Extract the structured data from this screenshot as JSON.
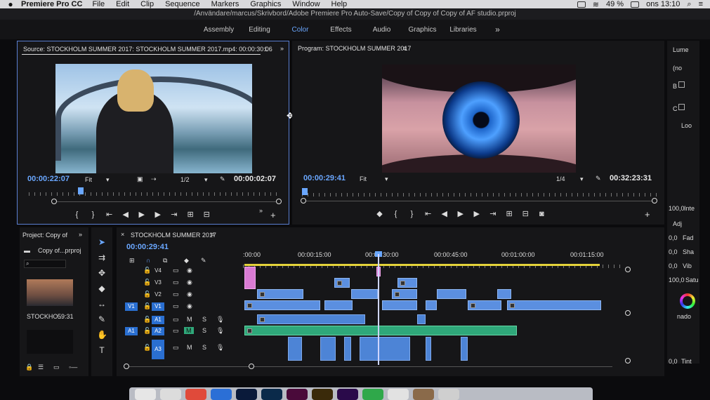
{
  "menubar": {
    "app_name": "Premiere Pro CC",
    "items": [
      "File",
      "Edit",
      "Clip",
      "Sequence",
      "Markers",
      "Graphics",
      "Window",
      "Help"
    ],
    "battery": "49 %",
    "clock": "ons 13:10"
  },
  "path": "/Användare/marcus/Skrivbord/Adobe Premiere Pro Auto-Save/Copy of Copy of Copy of AF studio.prproj",
  "workspaces": {
    "items": [
      "Assembly",
      "Editing",
      "Color",
      "Effects",
      "Audio",
      "Graphics",
      "Libraries"
    ],
    "active": "Color",
    "more": "»"
  },
  "source": {
    "title": "Source: STOCKHOLM SUMMER 2017: STOCKHOLM SUMMER 2017.mp4: 00:00:30:06",
    "tab_extra": "L",
    "timecode_left": "00:00:22:07",
    "fit": "Fit",
    "resolution": "1/2",
    "timecode_right": "00:00:02:07"
  },
  "program": {
    "title": "Program: STOCKHOLM SUMMER 2017",
    "timecode_left": "00:00:29:41",
    "fit": "Fit",
    "resolution": "1/4",
    "timecode_right": "00:32:23:31"
  },
  "lumetri": {
    "title": "Lume",
    "preset": "(no",
    "basic": "B",
    "creative": "C",
    "look": "Loo",
    "intensity": "100,0",
    "intensity_label": "Inte",
    "adjust": "Adj",
    "rows": [
      {
        "value": "0,0",
        "label": "Fad"
      },
      {
        "value": "0,0",
        "label": "Sha"
      },
      {
        "value": "0,0",
        "label": "Vib"
      },
      {
        "value": "100,0",
        "label": "Satu"
      }
    ],
    "shadow": "nado",
    "tint_value": "0,0",
    "tint_label": "Tint"
  },
  "project": {
    "title": "Project: Copy of",
    "file": "Copy of...prproj",
    "clip_name": "STOCKHO...",
    "clip_duration": "59:31"
  },
  "timeline": {
    "title": "STOCKHOLM SUMMER 2017",
    "timecode": "00:00:29:41",
    "ruler": [
      ":00:00",
      "00:00:15:00",
      "00:00:30:00",
      "00:00:45:00",
      "00:01:00:00",
      "00:01:15:00"
    ],
    "video_tracks": [
      "V4",
      "V3",
      "V2",
      "V1"
    ],
    "audio_tracks": [
      "A1",
      "A2",
      "A3"
    ],
    "source_v": "V1",
    "source_a": "A1",
    "mute": "M",
    "solo": "S"
  }
}
